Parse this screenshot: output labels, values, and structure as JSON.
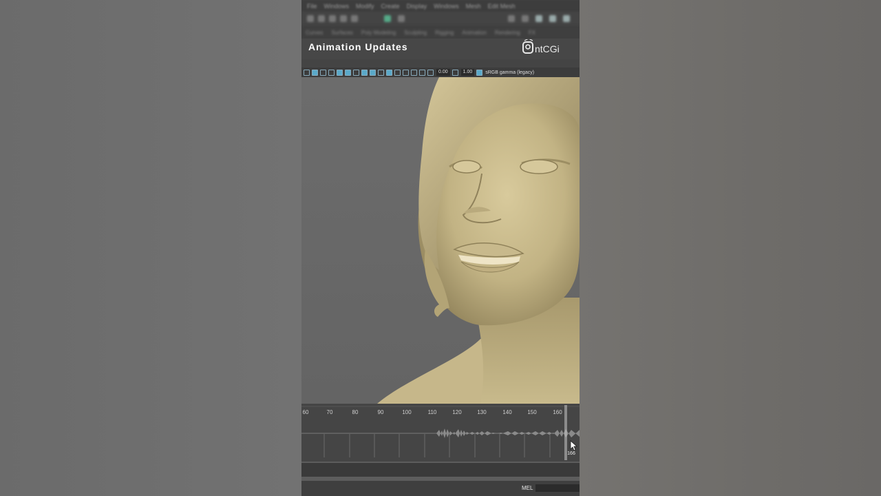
{
  "video": {
    "title": "Animation Updates",
    "logo_text": "AntCGi"
  },
  "menubar": [
    "File",
    "Windows",
    "Modify",
    "Create",
    "Display",
    "Windows",
    "Mesh",
    "Edit Mesh"
  ],
  "shelf_tabs": [
    "Curves",
    "Surfaces",
    "Poly Modeling",
    "Sculpting",
    "Rigging",
    "Animation",
    "Rendering",
    "FX"
  ],
  "viewport_toolbar": {
    "exposure": "0.00",
    "gamma": "1.00",
    "color_space": "sRGB gamma (legacy)"
  },
  "timeline": {
    "ticks": [
      "60",
      "70",
      "80",
      "90",
      "100",
      "110",
      "120",
      "130",
      "140",
      "150",
      "160"
    ],
    "current_frame": "166"
  },
  "command_line": {
    "language": "MEL"
  },
  "colors": {
    "skin": "#c7b88a",
    "accent_icon": "#5aa9c9",
    "playhead": "#cfcfcf"
  }
}
